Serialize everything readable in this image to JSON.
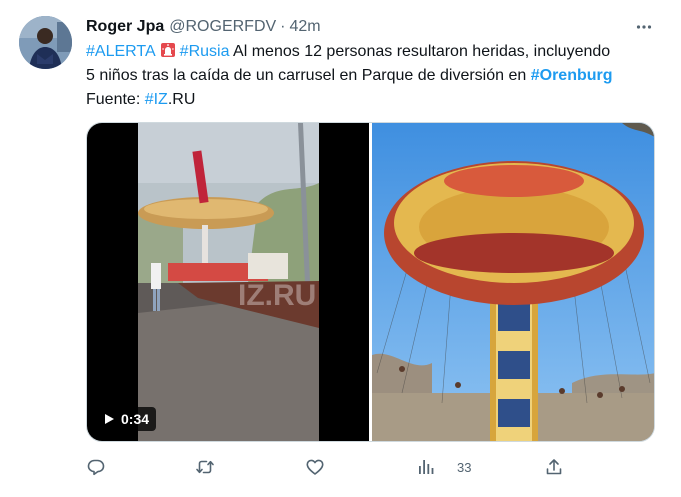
{
  "tweet": {
    "author_name": "Roger Jpa",
    "author_handle": "@ROGERFDV",
    "separator": "·",
    "time": "42m",
    "text": {
      "hashtag_alerta": "#ALERTA",
      "hashtag_rusia": "#Rusia",
      "line1_rest": " Al menos 12 personas resultaron heridas, incluyendo",
      "line2_pre": "5 niños tras la caída de un carrusel en Parque de diversión en ",
      "hashtag_orenburg": "#Orenburg",
      "line3_pre": "Fuente: ",
      "hashtag_iz": "#IZ",
      "line3_rest": ".RU"
    },
    "media": {
      "video_duration": "0:34",
      "watermark": "IZ.RU"
    },
    "actions": {
      "views_count": "33"
    }
  },
  "icons": {
    "avatar": "avatar-photo",
    "more": "more-horizontal-icon",
    "siren": "rotating-light-emoji",
    "reply": "reply-icon",
    "retweet": "retweet-icon",
    "like": "heart-icon",
    "views": "views-chart-icon",
    "share": "share-icon",
    "play": "play-icon"
  },
  "colors": {
    "link": "#1d9bf0",
    "text": "#0f1419",
    "muted": "#536471",
    "border": "#cfd9de"
  }
}
